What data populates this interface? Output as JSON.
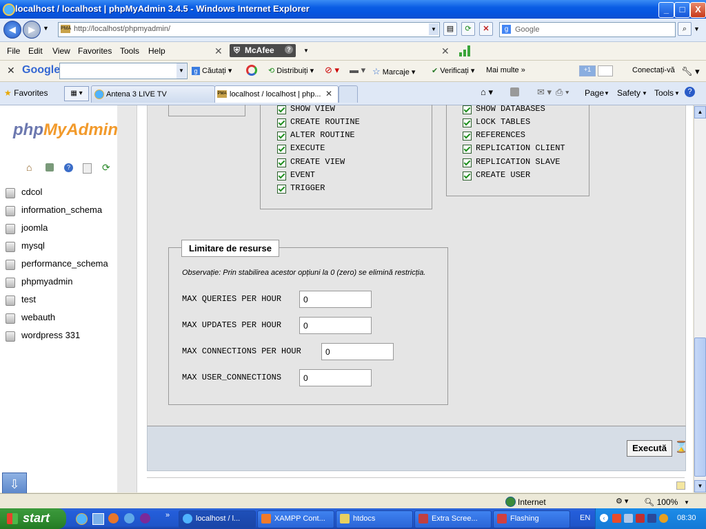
{
  "window": {
    "title": "localhost / localhost | phpMyAdmin 3.4.5 - Windows Internet Explorer",
    "min": "_",
    "max": "□",
    "close": "X"
  },
  "address": {
    "url": "http://localhost/phpmyadmin/",
    "search_placeholder": "Google"
  },
  "menu": {
    "items": [
      "File",
      "Edit",
      "View",
      "Favorites",
      "Tools",
      "Help"
    ],
    "mcafee": "McAfee"
  },
  "google_toolbar": {
    "logo": "Google",
    "search": "Căutați",
    "share": "Distribuiți",
    "bookmarks": "Marcaje",
    "check": "Verificați",
    "more": "Mai multe",
    "plus": "+1",
    "signin": "Conectați-vă"
  },
  "favorites_bar": {
    "favorites": "Favorites",
    "tabs": [
      "Antena 3 LIVE TV",
      "localhost / localhost | php..."
    ],
    "page": "Page",
    "safety": "Safety",
    "tools": "Tools"
  },
  "sidebar": {
    "logo_php": "php",
    "logo_myadmin": "MyAdmin",
    "databases": [
      "cdcol",
      "information_schema",
      "joomla",
      "mysql",
      "performance_schema",
      "phpmyadmin",
      "test",
      "webauth",
      "wordpress 331"
    ]
  },
  "privileges": {
    "col_middle": [
      "SHOW VIEW",
      "CREATE ROUTINE",
      "ALTER ROUTINE",
      "EXECUTE",
      "CREATE VIEW",
      "EVENT",
      "TRIGGER"
    ],
    "col_right": [
      "SHOW DATABASES",
      "LOCK TABLES",
      "REFERENCES",
      "REPLICATION CLIENT",
      "REPLICATION SLAVE",
      "CREATE USER"
    ]
  },
  "resources": {
    "legend": "Limitare de resurse",
    "note": "Observație: Prin stabilirea acestor opțiuni la 0 (zero) se elimină restricția.",
    "fields": [
      {
        "label": "MAX QUERIES PER HOUR",
        "value": "0"
      },
      {
        "label": "MAX UPDATES PER HOUR",
        "value": "0"
      },
      {
        "label": "MAX CONNECTIONS PER HOUR",
        "value": "0"
      },
      {
        "label": "MAX USER_CONNECTIONS",
        "value": "0"
      }
    ]
  },
  "execute_button": "Execută",
  "statusbar": {
    "zone": "Internet",
    "zoom": "100%"
  },
  "taskbar": {
    "start": "start",
    "tasks": [
      "localhost / l...",
      "XAMPP Cont...",
      "htdocs",
      "Extra Scree...",
      "Flashing"
    ],
    "lang": "EN",
    "clock": "08:30"
  }
}
